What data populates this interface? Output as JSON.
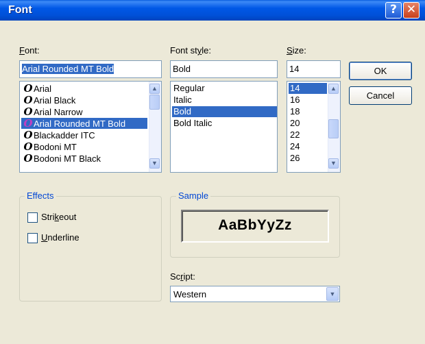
{
  "window": {
    "title": "Font",
    "help_label": "?",
    "close_label": "✕"
  },
  "font": {
    "label": "Font:",
    "value": "Arial Rounded MT Bold",
    "items": [
      {
        "label": "Arial",
        "selected": false
      },
      {
        "label": "Arial Black",
        "selected": false
      },
      {
        "label": "Arial Narrow",
        "selected": false
      },
      {
        "label": "Arial Rounded MT Bold",
        "selected": true
      },
      {
        "label": "Blackadder ITC",
        "selected": false
      },
      {
        "label": "Bodoni MT",
        "selected": false
      },
      {
        "label": "Bodoni MT Black",
        "selected": false
      }
    ],
    "glyph": "O"
  },
  "style": {
    "label": "Font style:",
    "value": "Bold",
    "items": [
      {
        "label": "Regular",
        "selected": false
      },
      {
        "label": "Italic",
        "selected": false
      },
      {
        "label": "Bold",
        "selected": true
      },
      {
        "label": "Bold Italic",
        "selected": false
      }
    ]
  },
  "size": {
    "label": "Size:",
    "value": "14",
    "items": [
      {
        "label": "14",
        "selected": true
      },
      {
        "label": "16",
        "selected": false
      },
      {
        "label": "18",
        "selected": false
      },
      {
        "label": "20",
        "selected": false
      },
      {
        "label": "22",
        "selected": false
      },
      {
        "label": "24",
        "selected": false
      },
      {
        "label": "26",
        "selected": false
      }
    ]
  },
  "buttons": {
    "ok": "OK",
    "cancel": "Cancel"
  },
  "effects": {
    "title": "Effects",
    "strikeout_pre": "Stri",
    "strikeout_key": "k",
    "strikeout_post": "eout",
    "underline_key": "U",
    "underline_post": "nderline",
    "strikeout_checked": false,
    "underline_checked": false
  },
  "sample": {
    "title": "Sample",
    "text": "AaBbYyZz"
  },
  "script": {
    "label_pre": "Sc",
    "label_key": "r",
    "label_post": "ipt:",
    "value": "Western"
  },
  "icons": {
    "scroll_up": "▲",
    "scroll_down": "▼",
    "dropdown": "▼"
  },
  "colors": {
    "selection": "#316ac5",
    "group_title": "#0046d5",
    "dialog_bg": "#ece9d8"
  }
}
